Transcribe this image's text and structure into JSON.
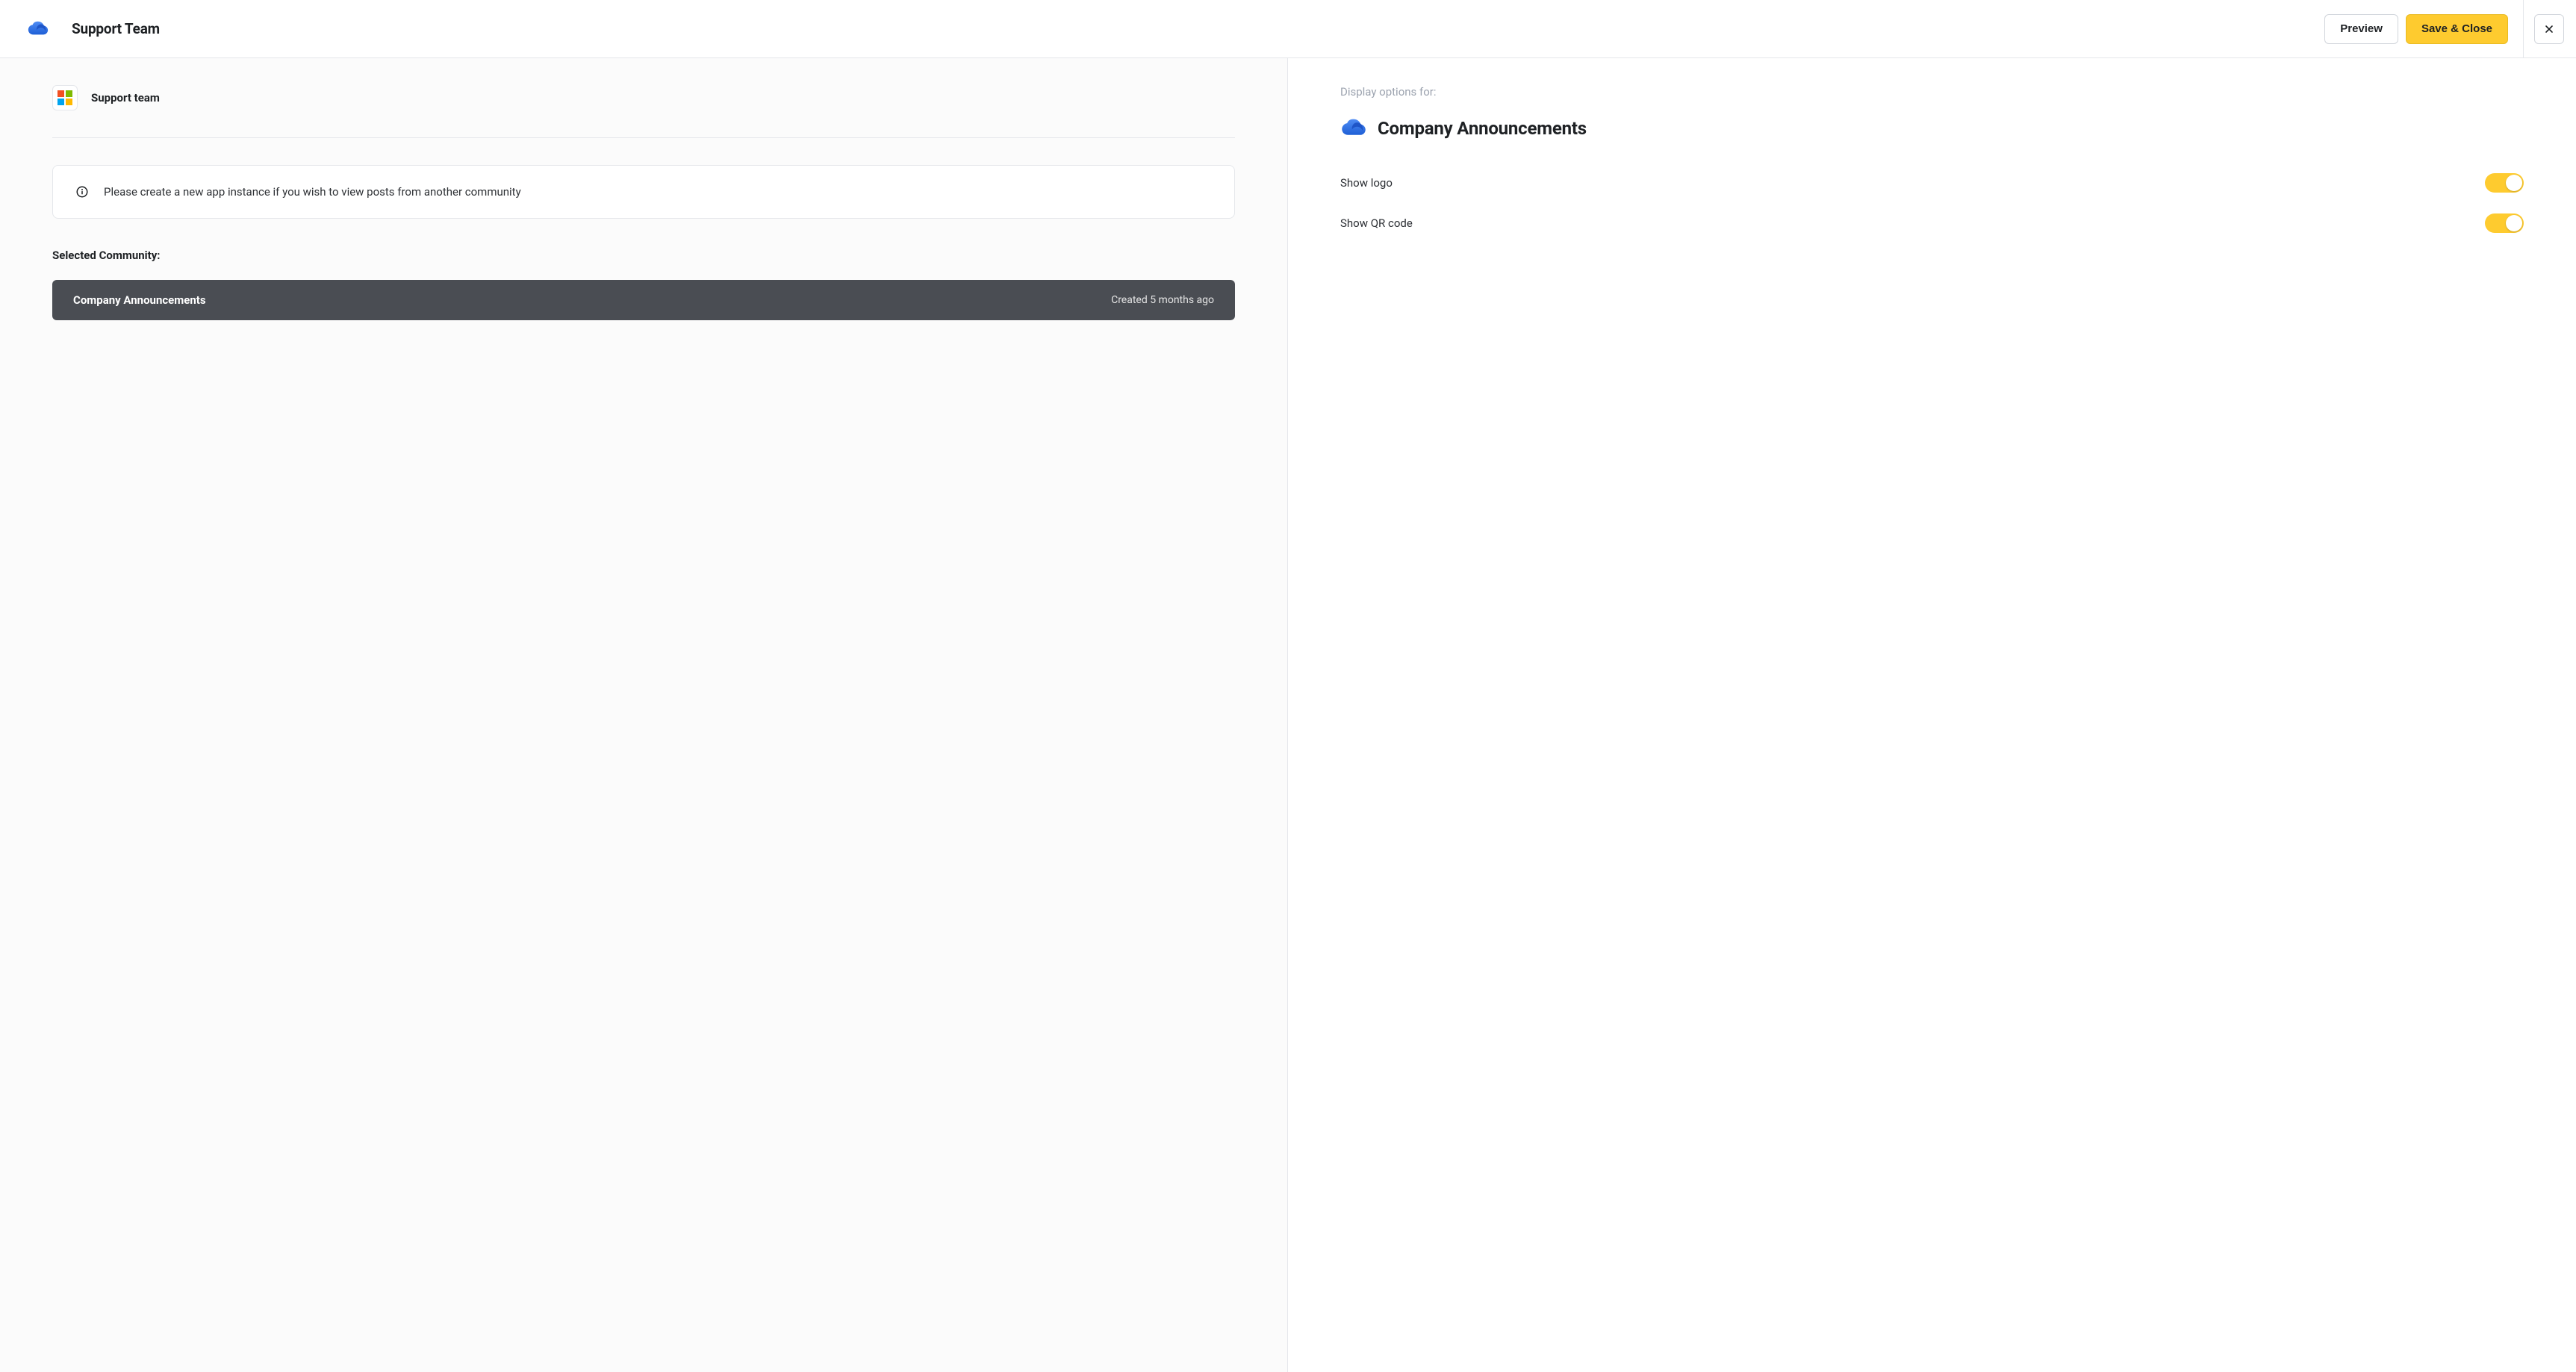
{
  "header": {
    "title": "Support Team",
    "preview_label": "Preview",
    "save_label": "Save & Close"
  },
  "left": {
    "org_name": "Support team",
    "info_message": "Please create a new app instance if you wish to view posts from another community",
    "selected_label": "Selected Community:",
    "community": {
      "name": "Company Announcements",
      "created_meta": "Created 5 months ago"
    }
  },
  "right": {
    "eyebrow": "Display options for:",
    "title": "Company Announcements",
    "options": {
      "show_logo": {
        "label": "Show logo",
        "value": true
      },
      "show_qr": {
        "label": "Show QR code",
        "value": true
      }
    }
  }
}
